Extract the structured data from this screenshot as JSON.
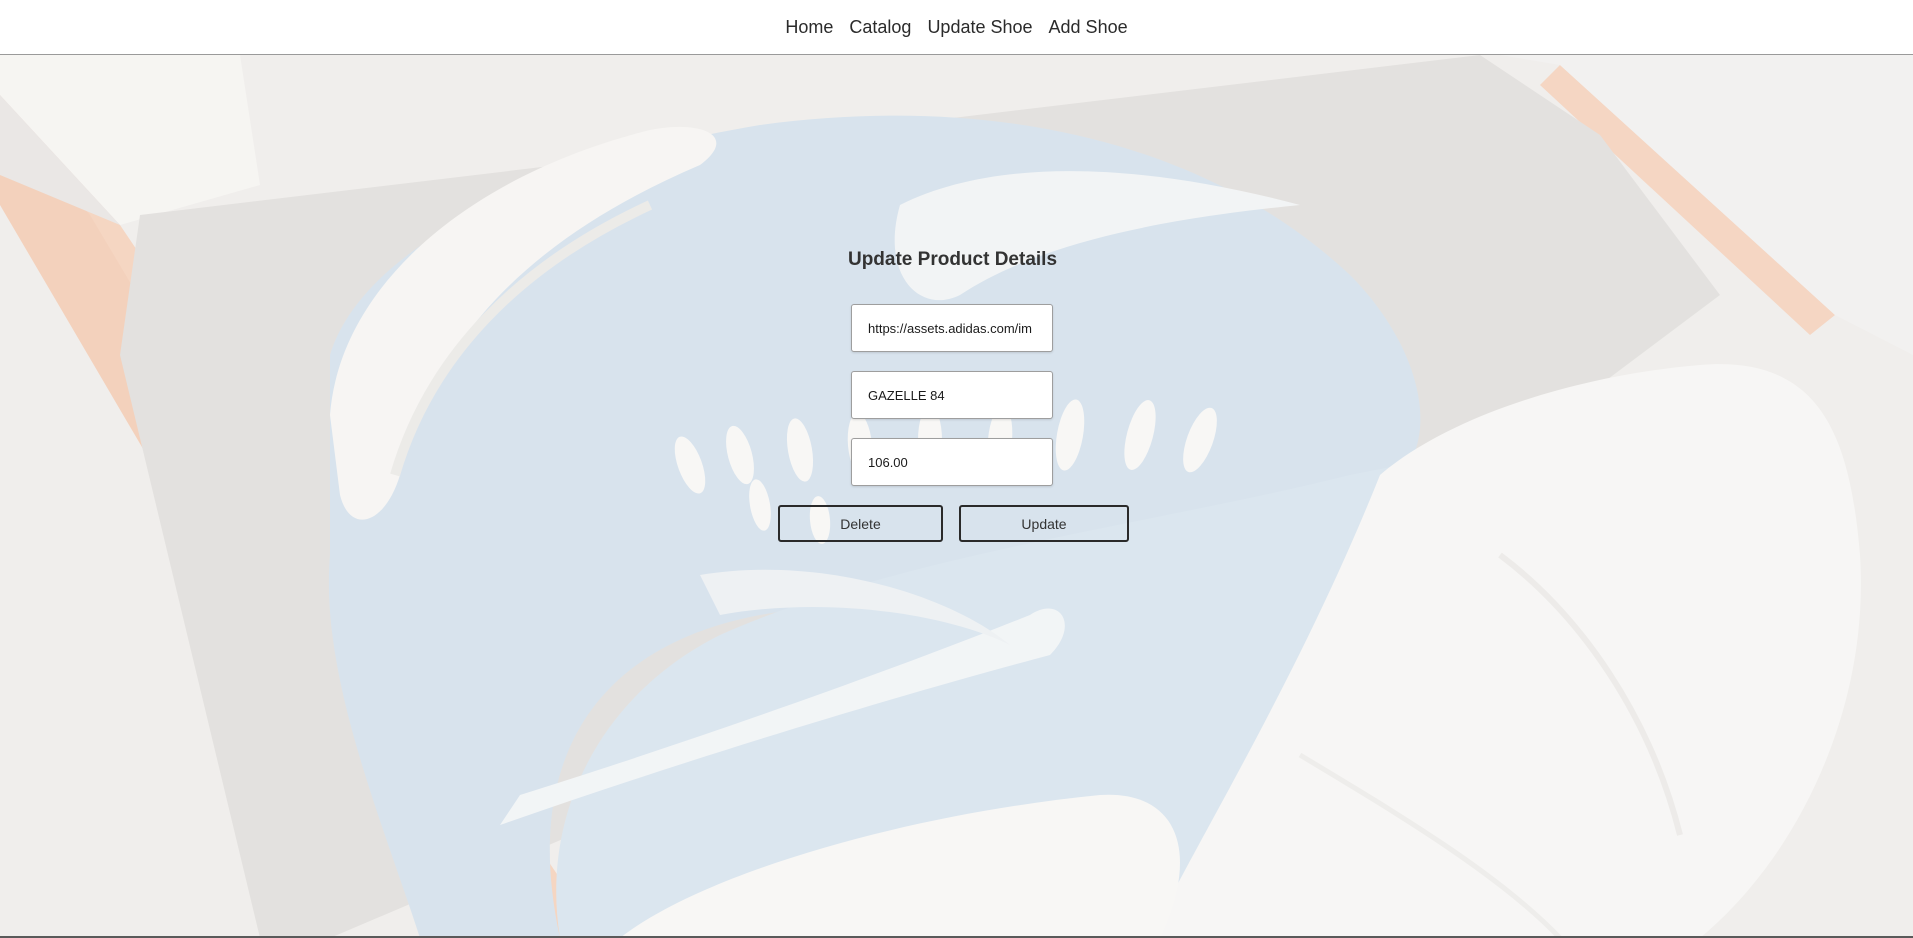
{
  "nav": {
    "items": [
      {
        "label": "Home"
      },
      {
        "label": "Catalog"
      },
      {
        "label": "Update Shoe"
      },
      {
        "label": "Add Shoe"
      }
    ]
  },
  "form": {
    "title": "Update Product Details",
    "image_url_value": "https://assets.adidas.com/im",
    "name_value": "GAZELLE 84",
    "price_value": "106.00",
    "delete_label": "Delete",
    "update_label": "Update"
  },
  "hero": {
    "icon": "sneaker-in-box-photo",
    "colors": {
      "background": "#ece9e6",
      "shoe_suede": "#c8d8e6",
      "box_orange": "#f2c1a3",
      "tissue": "#f4f3f1"
    }
  }
}
